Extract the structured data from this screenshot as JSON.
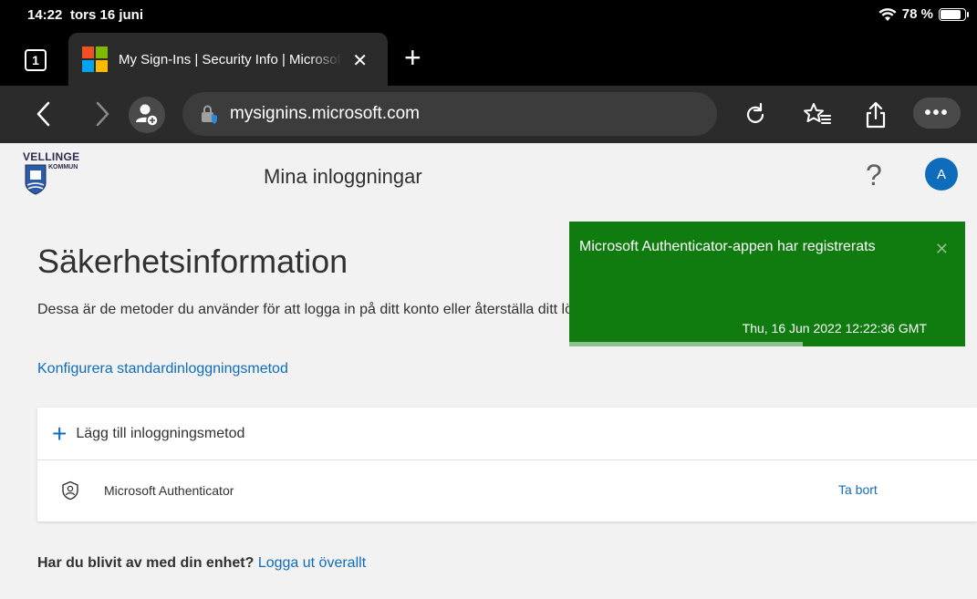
{
  "status_bar": {
    "time": "14:22",
    "date": "tors 16 juni",
    "battery": "78 %",
    "battery_level": 0.78
  },
  "browser": {
    "tab_count": "1",
    "tab_title": "My Sign-Ins | Security Info | Microsoft",
    "tab_close": "✕",
    "new_tab": "+",
    "url": "mysignins.microsoft.com"
  },
  "header": {
    "logo_line1": "VELLINGE",
    "logo_line2": "KOMMUN",
    "title": "Mina inloggningar",
    "help": "?",
    "avatar_initial": "A"
  },
  "main": {
    "title": "Säkerhetsinformation",
    "description": "Dessa är de metoder du använder för att logga in på ditt konto eller återställa ditt lösenord.",
    "config_link": "Konfigurera standardinloggningsmetod",
    "add_method": "Lägg till inloggningsmetod",
    "methods": [
      {
        "name": "Microsoft Authenticator",
        "action": "Ta bort"
      }
    ],
    "lost_device_question": "Har du blivit av med din enhet?",
    "lost_device_link": "Logga ut överallt"
  },
  "toast": {
    "message": "Microsoft Authenticator-appen har registrerats",
    "timestamp": "Thu, 16 Jun 2022 12:22:36 GMT",
    "close": "✕",
    "progress": 0.59,
    "color": "#107c10"
  },
  "colors": {
    "accent": "#0f6cbd",
    "success": "#107c10"
  }
}
